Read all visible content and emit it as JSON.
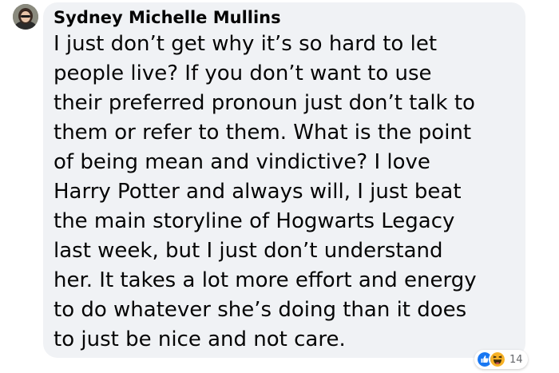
{
  "comment": {
    "author": "Sydney Michelle Mullins",
    "text_lines": [
      "I just don’t get why it’s so hard to let",
      "people live? If you don’t want to use",
      "their preferred pronoun just don’t talk to",
      "them or refer to them. What is the point",
      "of being mean and vindictive? I love",
      "Harry Potter and always will, I just beat",
      "the main storyline of Hogwarts Legacy",
      "last week, but I just don’t understand",
      "her. It takes a lot more effort and energy",
      "to do whatever she’s doing than it does",
      "to just be nice and not care."
    ],
    "reactions": {
      "icons": [
        "like-icon",
        "haha-icon"
      ],
      "count": "14"
    }
  },
  "colors": {
    "bubble_background": "#f0f2f5",
    "text": "#050505",
    "like_blue": "#1877f2",
    "haha_yellow": "#f7b125",
    "muted_text": "#65676b"
  }
}
